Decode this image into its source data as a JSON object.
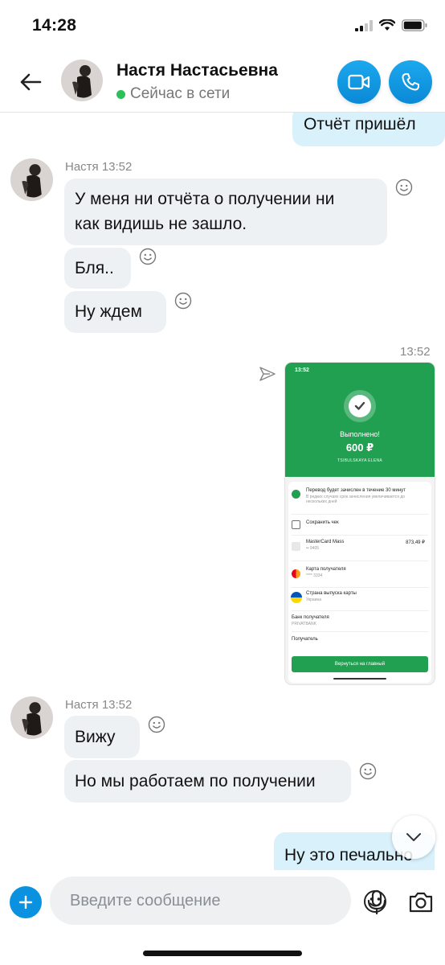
{
  "status_bar": {
    "time": "14:28"
  },
  "header": {
    "name": "Настя Настасьевна",
    "presence": "Сейчас в сети"
  },
  "messages": {
    "out_1": "Отчёт пришёл",
    "in_group_1": {
      "meta": "Настя 13:52",
      "msg_1_line_1": "У меня ни отчёта о получении ни",
      "msg_1_line_2": "как видишь не зашло.",
      "msg_2": "Бля..",
      "msg_3": "Ну ждем"
    },
    "image_message": {
      "time": "13:52",
      "screenshot": {
        "status_time": "13:52",
        "done_label": "Выполнено!",
        "amount": "600 ₽",
        "recipient_name": "TSIBULSKAYA ELENA",
        "row_transfer": "Перевод будет зачислен в течение 30 минут",
        "row_transfer_sub": "В редких случаях срок зачисления увеличивается до нескольких дней",
        "row_save": "Сохранить чек",
        "row_card": "MasterCard Mass",
        "row_card_sub": "•• 9405",
        "row_card_amount": "873,49 ₽",
        "row_recipient_card": "Карта получателя",
        "row_recipient_card_sub": "**** 3334",
        "row_country": "Страна выпуска карты",
        "row_country_sub": "Украина",
        "row_bank": "Банк получателя",
        "row_bank_sub": "PRIVATBANK",
        "row_receiver": "Получатель",
        "cta": "Вернуться на главный"
      }
    },
    "in_group_2": {
      "meta": "Настя 13:52",
      "msg_1": "Вижу",
      "msg_2": "Но мы работаем по получении"
    },
    "out_2": "Ну это печально"
  },
  "composer": {
    "placeholder": "Введите сообщение"
  },
  "colors": {
    "accent": "#0a92e0",
    "online": "#2dbf5c",
    "bubble_in": "#eef1f4",
    "bubble_out": "#d9f1fb",
    "receipt_green": "#22a052"
  }
}
